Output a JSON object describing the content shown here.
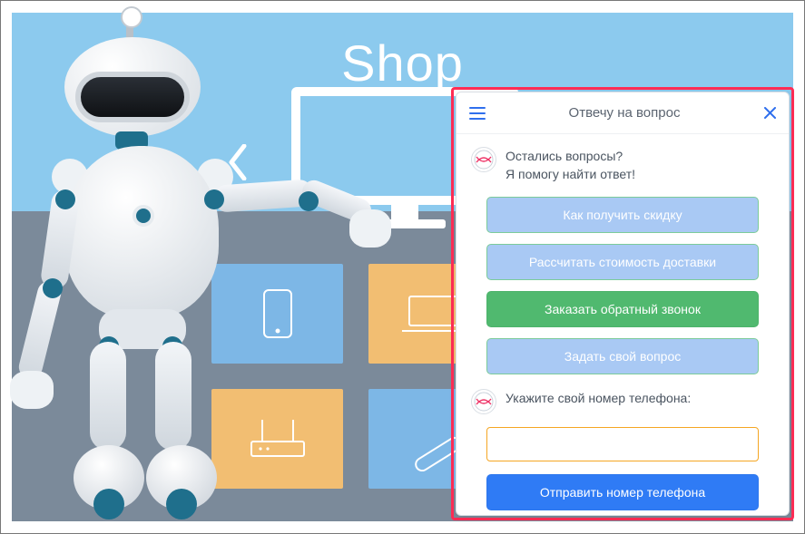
{
  "background": {
    "shop_label": "Shop",
    "tiles": [
      "phone",
      "laptop",
      "router",
      "stylus"
    ]
  },
  "widget": {
    "header_title": "Отвечу на вопрос",
    "greeting_line1": "Остались вопросы?",
    "greeting_line2": "Я помогу найти ответ!",
    "buttons": {
      "discount": "Как получить скидку",
      "shipping": "Рассчитать стоимость доставки",
      "callback": "Заказать обратный звонок",
      "ask": "Задать свой вопрос"
    },
    "phone_prompt": "Укажите свой номер телефона:",
    "phone_placeholder": "",
    "submit_label": "Отправить номер телефона"
  },
  "colors": {
    "accent_blue": "#2F7BF5",
    "soft_blue": "#A9C9F4",
    "green": "#50B96F",
    "highlight_border": "#FF2D55",
    "input_border": "#F5A623"
  }
}
